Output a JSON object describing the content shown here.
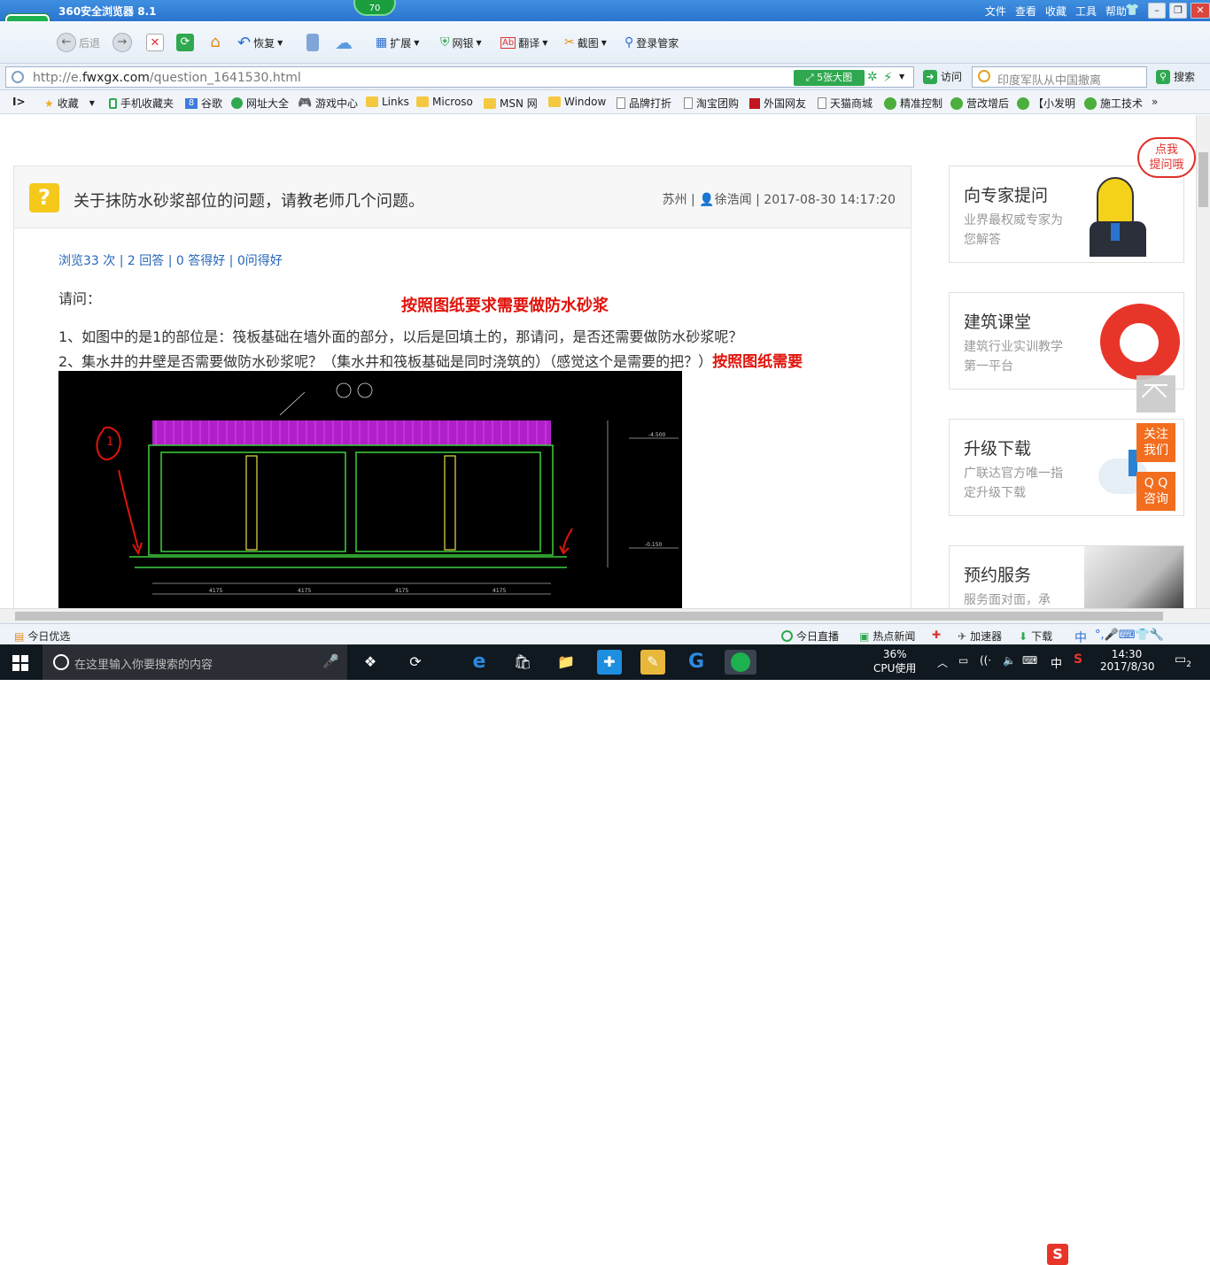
{
  "browser": {
    "title": "360安全浏览器 8.1",
    "badge": "70",
    "menu": [
      "文件",
      "查看",
      "收藏",
      "工具",
      "帮助"
    ],
    "toolbar": {
      "back": "后退",
      "restore": "恢复",
      "extend": "扩展",
      "netbank": "网银",
      "translate": "翻译",
      "screenshot": "截图",
      "login": "登录管家"
    },
    "address": {
      "url_prefix": "http://e.",
      "url_domain": "fwxgx.com",
      "url_path": "/question_1641530.html",
      "bigimg": "5张大图",
      "visit": "访问",
      "search_placeholder": "印度军队从中国撤离",
      "search": "搜索"
    },
    "favorites": [
      "收藏",
      "手机收藏夹",
      "谷歌",
      "网址大全",
      "游戏中心",
      "Links",
      "Microso",
      "MSN 网",
      "Window",
      "品牌打折",
      "淘宝团购",
      "外国网友",
      "天猫商城",
      "精准控制",
      "营改增后",
      "【小发明",
      "施工技术"
    ]
  },
  "question": {
    "title": "关于抹防水砂浆部位的问题，请教老师几个问题。",
    "meta_city": "苏州",
    "meta_user": "徐浩闻",
    "meta_time": "2017-08-30 14:17:20",
    "stats": "浏览33 次 | 2 回答 | 0 答得好 | 0问得好",
    "ask": "请问：",
    "red_note": "按照图纸要求需要做防水砂浆",
    "line1": "1、如图中的是1的部位是：筏板基础在墙外面的部分，以后是回填土的，那请问，是否还需要做防水砂浆呢？",
    "line2": "2、集水井的井壁是否需要做防水砂浆呢？（集水井和筏板基础是同时浇筑的）（感觉这个是需要的把？）",
    "line2_red": "按照图纸需要",
    "cad_labels": {
      "circle_mark": "1",
      "dims": [
        "4175",
        "4175",
        "4175",
        "4175"
      ],
      "levels": [
        "-4.500",
        "-0.150"
      ]
    }
  },
  "sidebar": {
    "speech": [
      "点我",
      "提问哦"
    ],
    "cards": [
      {
        "title": "向专家提问",
        "sub": "业界最权威专家为您解答"
      },
      {
        "title": "建筑课堂",
        "sub": "建筑行业实训教学第一平台"
      },
      {
        "title": "升级下载",
        "sub": "广联达官方唯一指定升级下载"
      },
      {
        "title": "预约服务",
        "sub": "服务面对面，承"
      }
    ],
    "follow": [
      "关注",
      "我们"
    ],
    "qq": [
      "Q Q",
      "咨询"
    ]
  },
  "statusbar": {
    "today": "今日优选",
    "live": "今日直播",
    "news": "热点新闻",
    "accel": "加速器",
    "download": "下载",
    "ime": "中"
  },
  "taskbar": {
    "search_placeholder": "在这里输入你要搜索的内容",
    "cpu_pct": "36%",
    "cpu_label": "CPU使用",
    "ime": "中",
    "time": "14:30",
    "date": "2017/8/30",
    "notif": "2"
  }
}
